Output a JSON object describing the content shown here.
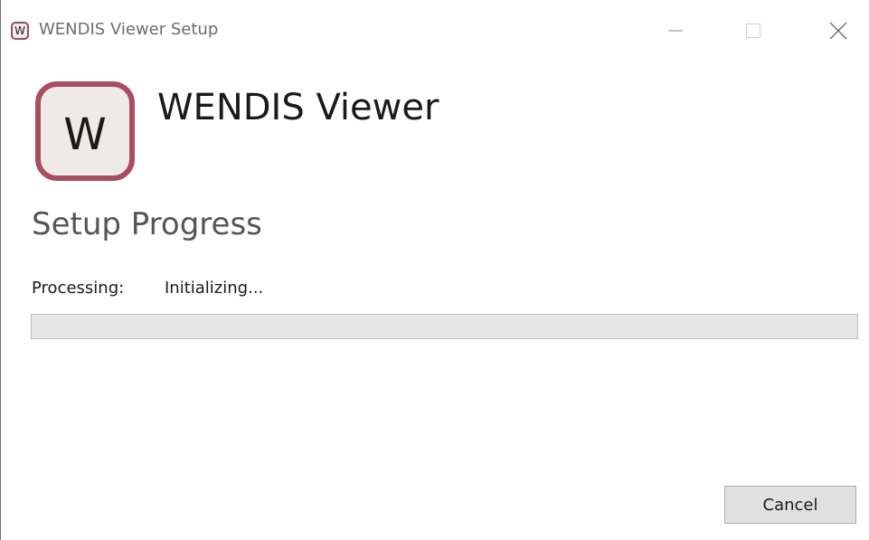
{
  "window": {
    "title": "WENDIS Viewer Setup",
    "icon_letter": "W",
    "controls": {
      "minimize": "minimize-icon",
      "maximize": "maximize-icon",
      "close": "close-icon"
    }
  },
  "header": {
    "logo_letter": "W",
    "app_name": "WENDIS Viewer"
  },
  "main": {
    "heading": "Setup Progress",
    "status_label": "Processing:",
    "status_value": "Initializing...",
    "progress_percent": 0
  },
  "footer": {
    "cancel_label": "Cancel"
  },
  "colors": {
    "brand_border": "#a84d62",
    "progress_track": "#e6e6e6",
    "button_face": "#e1e1e1"
  }
}
